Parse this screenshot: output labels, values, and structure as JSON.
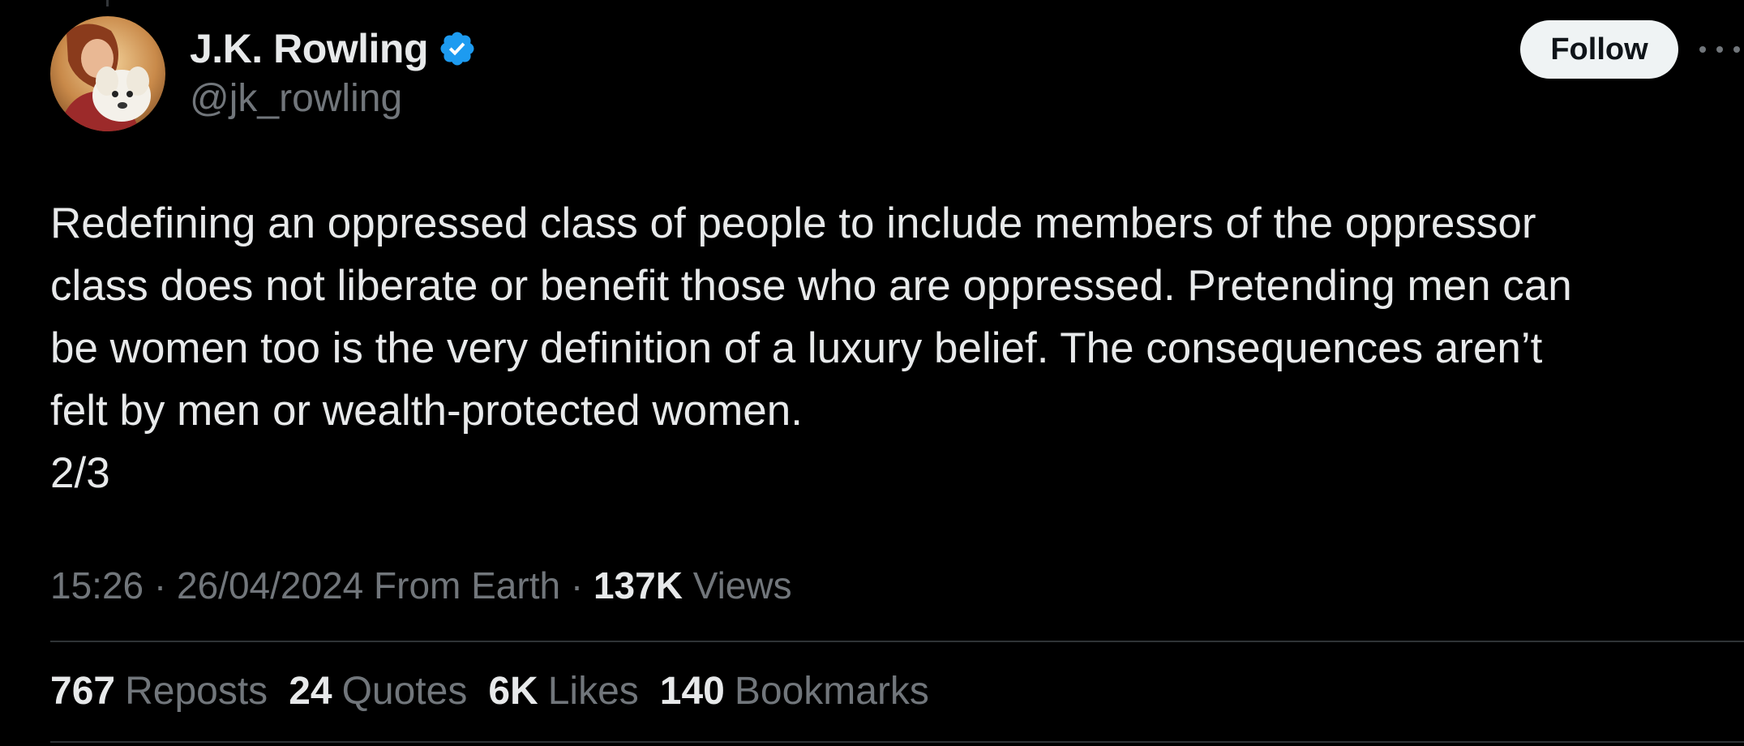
{
  "author": {
    "display_name": "J.K. Rowling",
    "handle": "@jk_rowling",
    "verified": true,
    "verified_color": "#1d9bf0"
  },
  "actions": {
    "follow_label": "Follow"
  },
  "tweet": {
    "text": "Redefining an oppressed class of people to include members of the oppressor\nclass does not liberate or benefit those who are oppressed. Pretending men can\nbe women too is the very definition of a luxury belief. The consequences aren’t\nfelt by men or wealth-protected women.\n2/3",
    "time": "15:26",
    "date": "26/04/2024",
    "source": "From Earth",
    "views_count": "137K",
    "views_label": "Views",
    "separator": "·"
  },
  "stats": [
    {
      "count": "767",
      "label": "Reposts"
    },
    {
      "count": "24",
      "label": "Quotes"
    },
    {
      "count": "6K",
      "label": "Likes"
    },
    {
      "count": "140",
      "label": "Bookmarks"
    }
  ],
  "colors": {
    "background": "#000000",
    "text_primary": "#e7e9ea",
    "text_secondary": "#71767b",
    "divider": "#2f3336"
  }
}
